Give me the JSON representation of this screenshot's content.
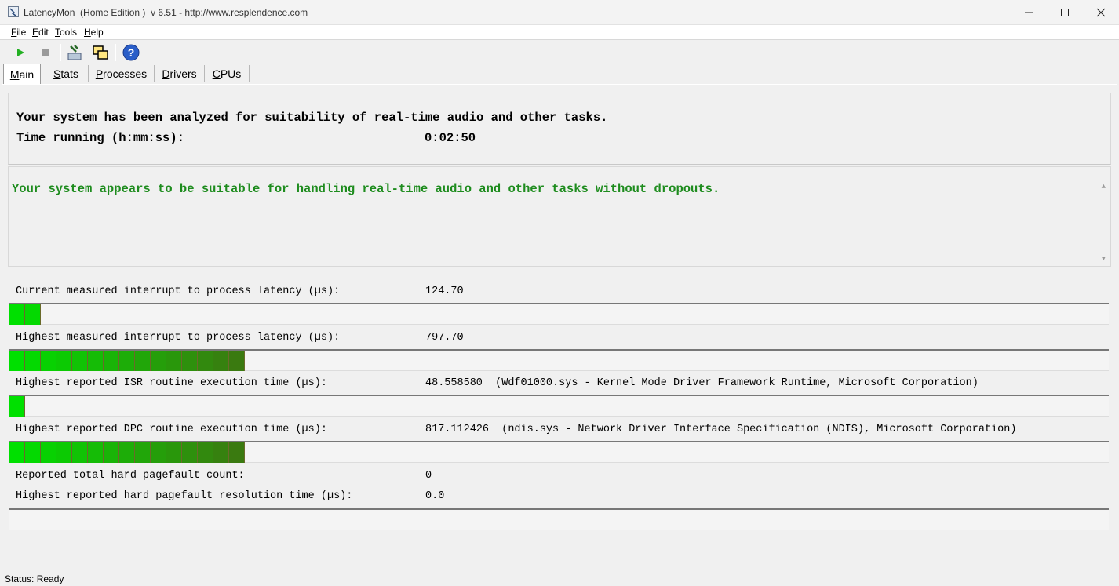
{
  "window": {
    "title": "LatencyMon  (Home Edition )  v 6.51 - http://www.resplendence.com",
    "minimize_icon": "minimize-icon",
    "maximize_icon": "maximize-icon",
    "close_icon": "close-icon"
  },
  "menu": {
    "items": [
      "File",
      "Edit",
      "Tools",
      "Help"
    ]
  },
  "toolbar": {
    "buttons": [
      "play-icon",
      "stop-icon",
      "hammer-icon",
      "windows-icon",
      "help-icon"
    ]
  },
  "tabs": [
    {
      "label": "Main",
      "active": true
    },
    {
      "label": "Stats",
      "active": false
    },
    {
      "label": "Processes",
      "active": false
    },
    {
      "label": "Drivers",
      "active": false
    },
    {
      "label": "CPUs",
      "active": false
    }
  ],
  "header": {
    "line1": "Your system has been analyzed for suitability of real-time audio and other tasks.",
    "time_label": "Time running (h:mm:ss):",
    "time_value": "0:02:50"
  },
  "verdict": {
    "message": "Your system appears to be suitable for handling real-time audio and other tasks without dropouts.",
    "color": "#1e8c1e"
  },
  "stats": {
    "current_latency": {
      "label": "Current measured interrupt to process latency (µs):",
      "value": "124.70",
      "bar_segments": 2
    },
    "highest_latency": {
      "label": "Highest measured interrupt to process latency (µs):",
      "value": "797.70",
      "bar_segments": 15
    },
    "isr": {
      "label": "Highest reported ISR routine execution time (µs):",
      "value": "48.558580  (Wdf01000.sys - Kernel Mode Driver Framework Runtime, Microsoft Corporation)",
      "bar_segments": 1
    },
    "dpc": {
      "label": "Highest reported DPC routine execution time (µs):",
      "value": "817.112426  (ndis.sys - Network Driver Interface Specification (NDIS), Microsoft Corporation)",
      "bar_segments": 15
    },
    "pagefault_count": {
      "label": "Reported total hard pagefault count:",
      "value": "0"
    },
    "pagefault_time": {
      "label": "Highest reported hard pagefault resolution time (µs):",
      "value": "0.0",
      "bar_segments": 0
    }
  },
  "status": {
    "text": "Status: Ready"
  },
  "colors": {
    "bar_start": "#00e000",
    "bar_end": "#3a7a10"
  }
}
